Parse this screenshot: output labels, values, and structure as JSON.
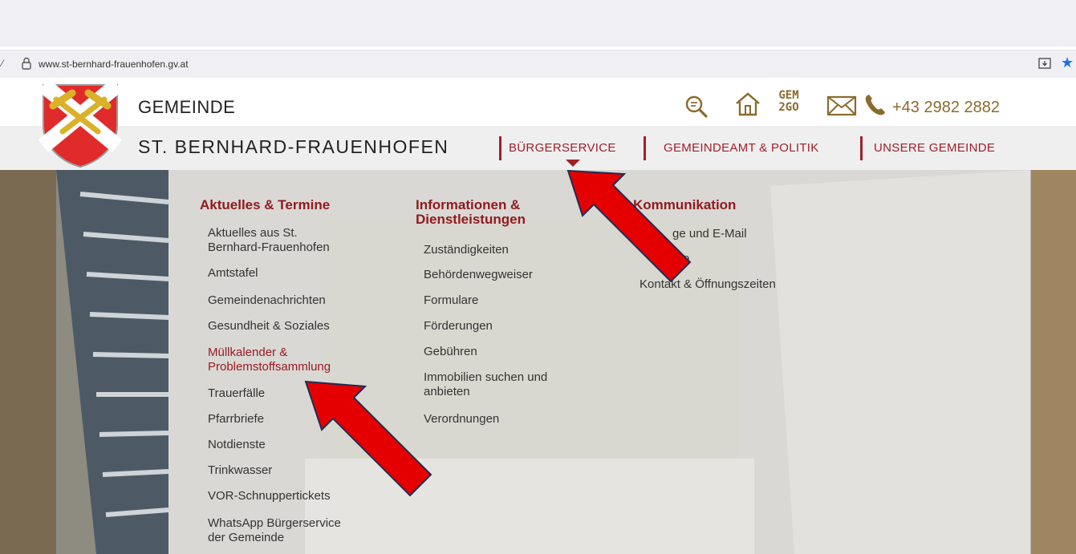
{
  "browser": {
    "url": "www.st-bernhard-frauenhofen.gv.at",
    "left_glyph": "⁄",
    "lock_icon": "lock-icon",
    "star_icon": "bookmark-star-icon",
    "install_icon": "install-app-icon"
  },
  "header": {
    "line1": "GEMEINDE",
    "line2": "ST. BERNHARD-FRAUENHOFEN",
    "phone": "+43 2982 2882",
    "icons": [
      "search-icon",
      "home-icon",
      "gem2go-icon",
      "mail-icon",
      "phone-icon"
    ],
    "gem2go_top": "GEM",
    "gem2go_bottom": "2GO",
    "accent_color": "#a0202a",
    "icon_color": "#8b6a2c"
  },
  "nav": {
    "items": [
      "BÜRGERSERVICE",
      "GEMEINDEAMT & POLITIK",
      "UNSERE GEMEINDE"
    ]
  },
  "dropdown": {
    "col1": {
      "heading": "Aktuelles & Termine",
      "links": [
        [
          "Aktuelles aus St.",
          "Bernhard-Frauenhofen"
        ],
        [
          "Amtstafel"
        ],
        [
          "Gemeindenachrichten"
        ],
        [
          "Gesundheit & Soziales"
        ],
        [
          "Müllkalender &",
          "Problemstoffsammlung"
        ],
        [
          "Trauerfälle"
        ],
        [
          "Pfarrbriefe"
        ],
        [
          "Notdienste"
        ],
        [
          "Trinkwasser"
        ],
        [
          "VOR-Schnuppertickets"
        ],
        [
          "WhatsApp Bürgerservice",
          "der Gemeinde"
        ]
      ]
    },
    "col2": {
      "heading_line1": "Informationen &",
      "heading_line2": "Dienstleistungen",
      "links": [
        [
          "Zuständigkeiten"
        ],
        [
          "Behördenwegweiser"
        ],
        [
          "Formulare"
        ],
        [
          "Förderungen"
        ],
        [
          "Gebühren"
        ],
        [
          "Immobilien suchen und",
          "anbieten"
        ],
        [
          "Verordnungen"
        ]
      ]
    },
    "col3": {
      "heading": "Kommunikation",
      "links": [
        [
          "ge und E-Mail"
        ],
        [
          "o"
        ],
        [
          "Kontakt & Öffnungszeiten"
        ]
      ]
    }
  },
  "annotations": {
    "arrow_color": "#e50000",
    "arrow_outline": "#1f2d52"
  }
}
